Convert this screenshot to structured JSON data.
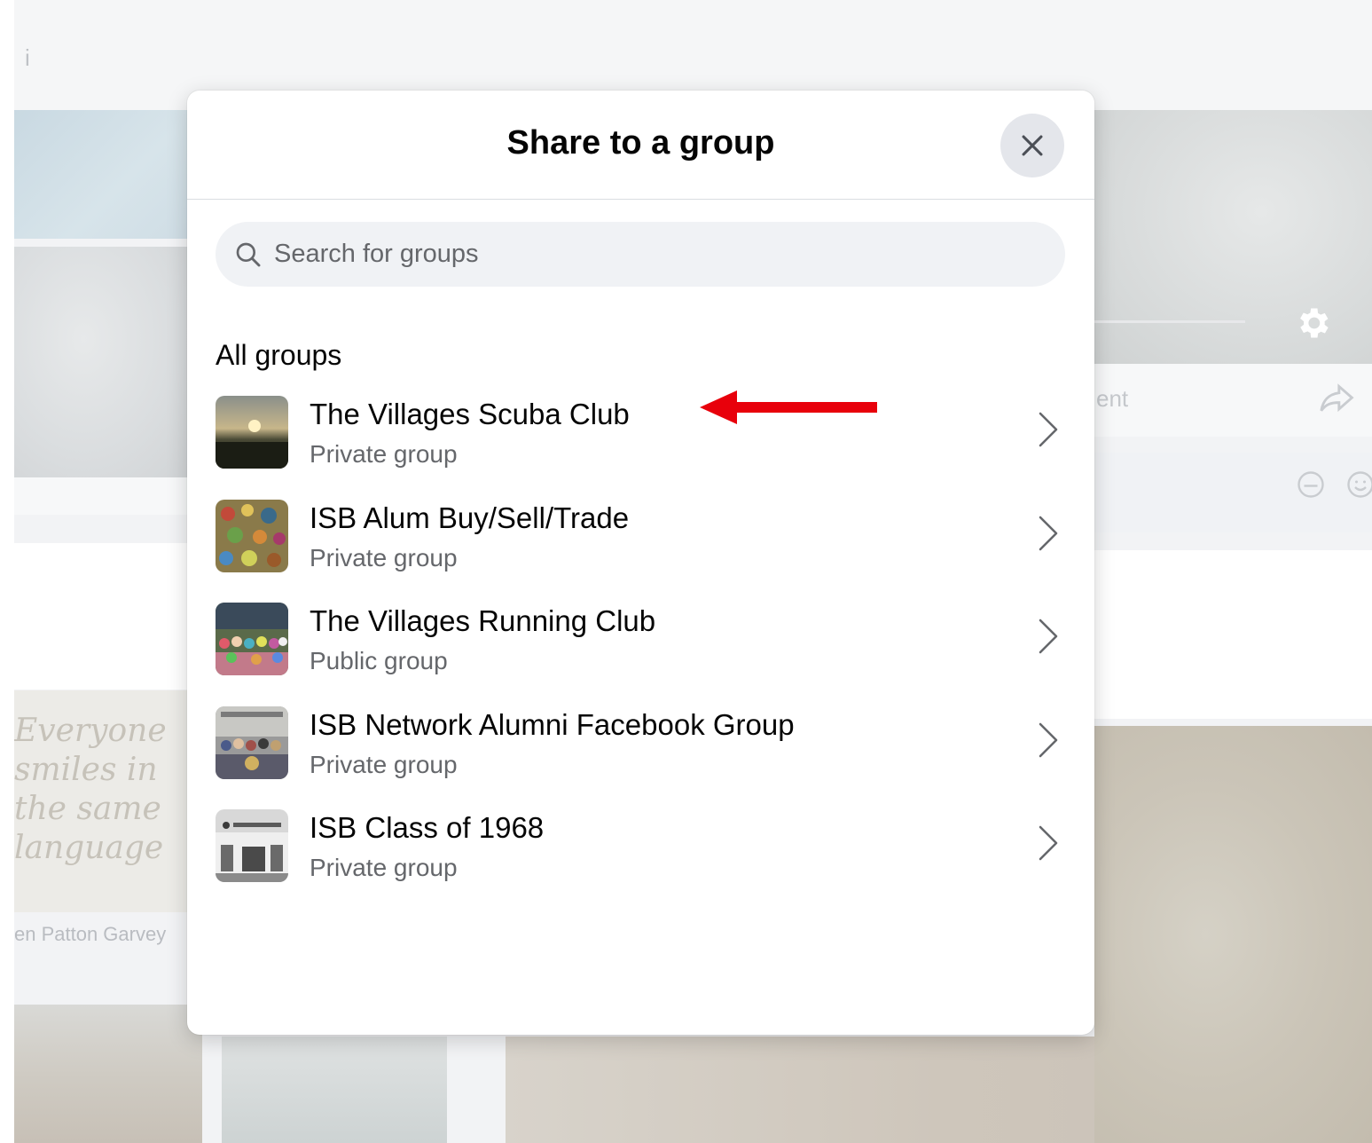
{
  "background": {
    "topbar_glyph": "i",
    "quote_lines": [
      "Everyone",
      "smiles in",
      "the same",
      "language"
    ],
    "caption": "en Patton Garvey",
    "right_bar_text": "ent"
  },
  "modal": {
    "title": "Share to a group",
    "search": {
      "placeholder": "Search for groups",
      "value": ""
    },
    "section_heading": "All groups",
    "groups": [
      {
        "name": "The Villages Scuba Club",
        "privacy": "Private group",
        "thumb_icon": "sunset-photo"
      },
      {
        "name": "ISB Alum Buy/Sell/Trade",
        "privacy": "Private group",
        "thumb_icon": "market-photo"
      },
      {
        "name": "The Villages Running Club",
        "privacy": "Public group",
        "thumb_icon": "crowd-photo"
      },
      {
        "name": "ISB Network Alumni Facebook Group",
        "privacy": "Private group",
        "thumb_icon": "group-photo"
      },
      {
        "name": "ISB Class of 1968",
        "privacy": "Private group",
        "thumb_icon": "building-photo"
      }
    ]
  },
  "colors": {
    "modal_bg": "#ffffff",
    "search_bg": "#f0f2f5",
    "close_bg": "#e4e6eb",
    "primary_text": "#050505",
    "secondary_text": "#65676b",
    "annotation_arrow": "#e8000b"
  }
}
